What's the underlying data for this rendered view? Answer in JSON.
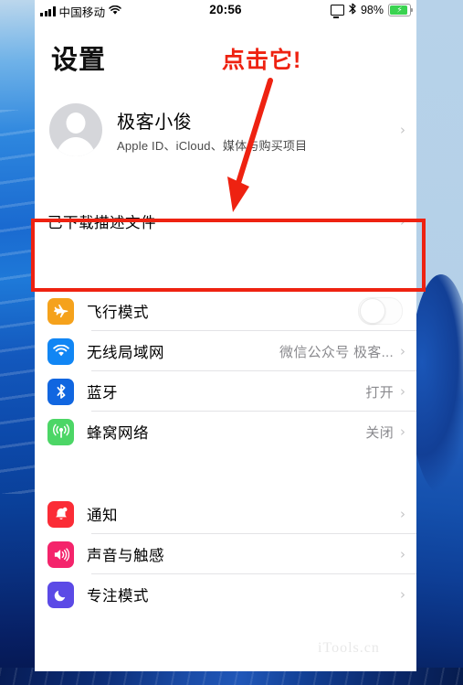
{
  "statusbar": {
    "carrier": "中国移动",
    "signal_icon": "signal-bars-icon",
    "wifi_icon": "wifi-icon",
    "time": "20:56",
    "screen_mirror_icon": "screen-mirroring-icon",
    "bluetooth_icon": "bluetooth-icon",
    "battery_percent": "98%",
    "battery_icon": "battery-charging-icon",
    "battery_bolt": "⚡"
  },
  "header": {
    "title": "设置"
  },
  "account": {
    "name": "极客小俊",
    "subtitle": "Apple ID、iCloud、媒体与购买项目",
    "avatar_icon": "avatar-placeholder-icon",
    "chevron": "›"
  },
  "profile_row": {
    "label": "已下载描述文件",
    "chevron": "›"
  },
  "annotation": {
    "text": "点击它!",
    "color": "#ee2211",
    "arrow_icon": "red-arrow-icon",
    "highlight_icon": "red-highlight-box"
  },
  "connectivity": {
    "rows": [
      {
        "label": "飞行模式",
        "icon": "airplane-icon",
        "glyph": "✈",
        "icon_color": "#f5a21c",
        "control": "toggle",
        "toggle_on": false,
        "value": "",
        "chevron": ""
      },
      {
        "label": "无线局域网",
        "icon": "wifi-icon",
        "glyph": "●",
        "icon_color": "#1186f4",
        "control": "chevron",
        "value": "微信公众号 极客...",
        "chevron": "›"
      },
      {
        "label": "蓝牙",
        "icon": "bluetooth-icon",
        "glyph": "ᛦ",
        "icon_color": "#1166e0",
        "control": "chevron",
        "value": "打开",
        "chevron": "›"
      },
      {
        "label": "蜂窝网络",
        "icon": "cellular-icon",
        "glyph": "((p))",
        "icon_color": "#4cd666",
        "control": "chevron",
        "value": "关闭",
        "chevron": "›"
      }
    ]
  },
  "notifications_group": {
    "rows": [
      {
        "label": "通知",
        "icon": "bell-icon",
        "glyph": "🔔",
        "icon_color": "#fb2c36",
        "value": "",
        "chevron": "›"
      },
      {
        "label": "声音与触感",
        "icon": "speaker-icon",
        "glyph": "🔊",
        "icon_color": "#f4246b",
        "value": "",
        "chevron": "›"
      },
      {
        "label": "专注模式",
        "icon": "moon-icon",
        "glyph": "🌙",
        "icon_color": "#5b4ae6",
        "value": "",
        "chevron": "›"
      }
    ]
  },
  "watermark": {
    "text": "iTools.cn"
  }
}
